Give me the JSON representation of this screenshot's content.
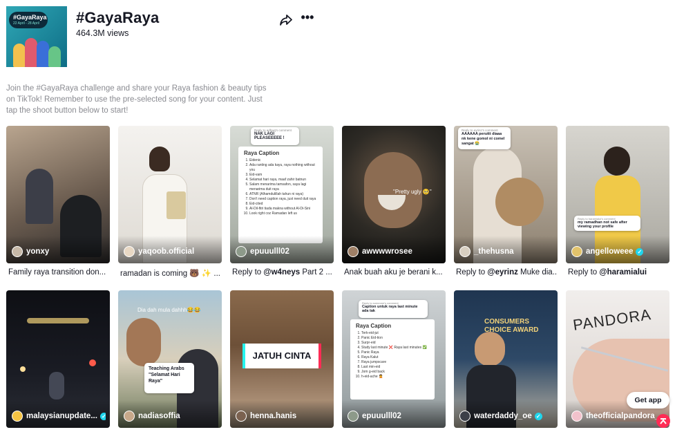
{
  "hashtag": {
    "title": "#GayaRaya",
    "views": "464.3M views",
    "description": "Join the #GayaRaya challenge and share your Raya fashion & beauty tips on TikTok! Remember to use the pre-selected song for your content. Just tap the shoot button below to start!",
    "cover_text": "#GayaRaya",
    "cover_dates": "22 April - 28 April"
  },
  "actions": {
    "share_icon": "share-arrow-icon",
    "more_icon": "more-dots-icon",
    "more_label": "•••"
  },
  "videos": [
    {
      "author": "yonxy",
      "caption_parts": [
        "Family raya transition don..."
      ],
      "verified": false
    },
    {
      "author": "yaqoob.official",
      "caption_parts": [
        "ramadan is coming 🐻 ✨ ..."
      ],
      "verified": false
    },
    {
      "author": "epuuulll02",
      "caption_parts": [
        "Reply to ",
        "@w4neys",
        " Part 2 ..."
      ],
      "verified": false,
      "overlay_reply": "Reply to adhwq's comment",
      "overlay_text": "NAK LAGI PLEASEEEEE !",
      "list_title": "Raya Caption",
      "list_items": [
        "Eidenic",
        "Ada ranting ada kayu, raya nothing without you",
        "Eid-vam",
        "Selamat hari raya, maaf zahir batnun",
        "Salam menarima tamsafon, saya lagi menarima duit raya",
        "ATNR (Alhamdulillah tahun ni raya)",
        "Don't need caption raya, just need duit raya",
        "Eid-cited",
        "Al-Dil-fitri tiada makna without Al-Di-Sini",
        "Look right coz Ramadan left us"
      ]
    },
    {
      "author": "awwwwrosee",
      "caption_parts": [
        "Anak buah aku je berani k..."
      ],
      "verified": false,
      "overlay_text": "\"Pretty ugly 🥺\""
    },
    {
      "author": "_thehusna",
      "caption_parts": [
        "Reply to ",
        "@eyrinz",
        " Muke dia..."
      ],
      "verified": false,
      "overlay_reply": "Reply to eyrinz's comment",
      "overlay_text": "AAAAAA peruttt diaaa nk kene gomol ni comel sangat 😭"
    },
    {
      "author": "angelloweee",
      "caption_parts": [
        "Reply to ",
        "@haramialui"
      ],
      "verified": true,
      "overlay_reply": "Reply to haramialui's comment",
      "overlay_text": "my ramadhan not safe after viewing your profile"
    },
    {
      "author": "malaysianupdate...",
      "caption_parts": [
        ""
      ],
      "verified": true
    },
    {
      "author": "nadiasoffia",
      "caption_parts": [
        ""
      ],
      "verified": false,
      "overlay_top": "Dia dah mula dahhh😂😂",
      "overlay_text": "Teaching Arabs \"Selamat Hari Raya\""
    },
    {
      "author": "henna.hanis",
      "caption_parts": [
        ""
      ],
      "verified": false,
      "overlay_text": "JATUH CINTA"
    },
    {
      "author": "epuuulll02",
      "caption_parts": [
        ""
      ],
      "verified": false,
      "overlay_reply": "Reply to someone's comment",
      "overlay_text": "Caption untuk raya last minute ada tak",
      "list_title": "Raya Caption",
      "list_items": [
        "Terk-eid-jut",
        "Panic Eid-tion",
        "Surpr-eid",
        "Study last minute ❌ Raya last minutes ✅",
        "Panic Raya",
        "Raya Kalut",
        "Raya jumpscare",
        "Last min-eid",
        "Jom g-eid back",
        "h-eid-ache 🤦"
      ]
    },
    {
      "author": "waterdaddy_oe",
      "caption_parts": [
        ""
      ],
      "verified": true,
      "overlay_text": "CONSUMERS CHOICE AWARD"
    },
    {
      "author": "theofficialpandora_...",
      "caption_parts": [
        ""
      ],
      "verified": false,
      "overlay_text": "PANDORA"
    }
  ],
  "floating": {
    "get_app": "Get app",
    "back_to_top_icon": "arrow-up-icon"
  },
  "colors": {
    "accent": "#fe2c55",
    "verified": "#20d5ec",
    "text": "#161823",
    "muted": "#8a8b91"
  }
}
